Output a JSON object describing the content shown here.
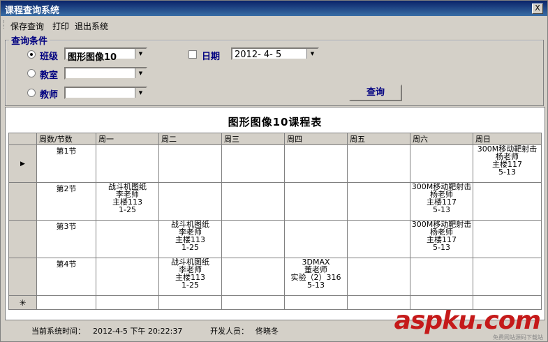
{
  "window": {
    "title": "课程查询系统",
    "close_label": "X"
  },
  "menu": {
    "items": [
      "保存查询",
      "打印",
      "退出系统"
    ]
  },
  "filters": {
    "group_title": "查询条件",
    "class": {
      "label": "班级",
      "value": "图形图像10"
    },
    "room": {
      "label": "教室",
      "value": ""
    },
    "teacher": {
      "label": "教师",
      "value": ""
    },
    "date": {
      "label": "日期",
      "value": "2012- 4- 5"
    },
    "query_button": "查询"
  },
  "timetable": {
    "title": "图形图像10课程表",
    "headers": [
      "周数/节数",
      "周一",
      "周二",
      "周三",
      "周四",
      "周五",
      "周六",
      "周日"
    ],
    "rows": [
      {
        "slot": "第1节",
        "cells": [
          [],
          [],
          [],
          [],
          [],
          [],
          [
            "300M移动靶射击",
            "杨老师",
            "主楼117",
            "5-13"
          ]
        ]
      },
      {
        "slot": "第2节",
        "cells": [
          [
            "战斗机图纸",
            "李老师",
            "主楼113",
            "1-25"
          ],
          [],
          [],
          [],
          [],
          [
            "300M移动靶射击",
            "杨老师",
            "主楼117",
            "5-13"
          ],
          []
        ]
      },
      {
        "slot": "第3节",
        "cells": [
          [],
          [
            "战斗机图纸",
            "李老师",
            "主楼113",
            "1-25"
          ],
          [],
          [],
          [],
          [
            "300M移动靶射击",
            "杨老师",
            "主楼117",
            "5-13"
          ],
          []
        ]
      },
      {
        "slot": "第4节",
        "cells": [
          [],
          [
            "战斗机图纸",
            "李老师",
            "主楼113",
            "1-25"
          ],
          [],
          [
            "3DMAX",
            "董老师",
            "实验（2）316",
            "5-13"
          ],
          [],
          [],
          []
        ]
      }
    ],
    "current_marker": "▶",
    "new_row_marker": "✳"
  },
  "status": {
    "time_label": "当前系统时间：",
    "time_value": "2012-4-5 下午 20:22:37",
    "dev_label": "开发人员：",
    "dev_value": "佟晓冬"
  },
  "watermark": {
    "logo": "aspku.com",
    "sub": "免费网站源码下载站"
  }
}
